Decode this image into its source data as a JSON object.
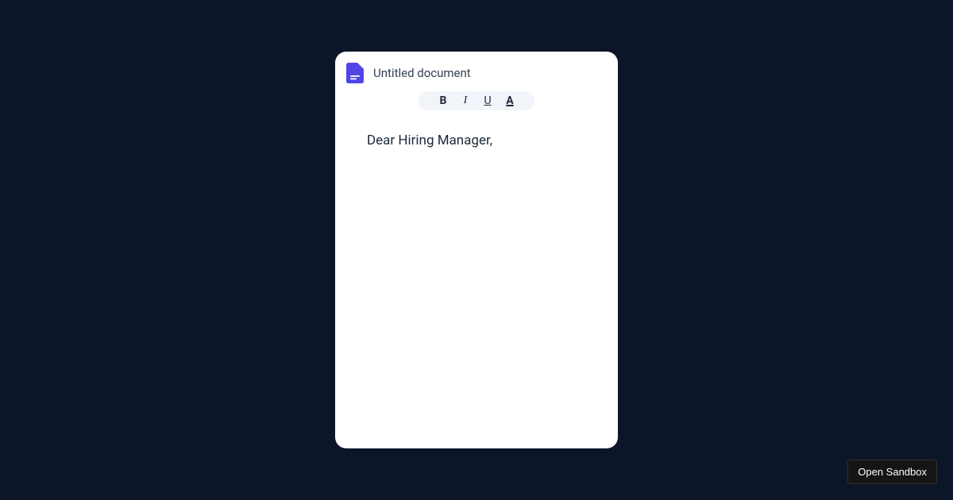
{
  "document": {
    "title": "Untitled document",
    "content": "Dear Hiring Manager,"
  },
  "toolbar": {
    "bold": "B",
    "italic": "I",
    "underline": "U",
    "textColor": "A"
  },
  "sandbox": {
    "label": "Open Sandbox"
  }
}
